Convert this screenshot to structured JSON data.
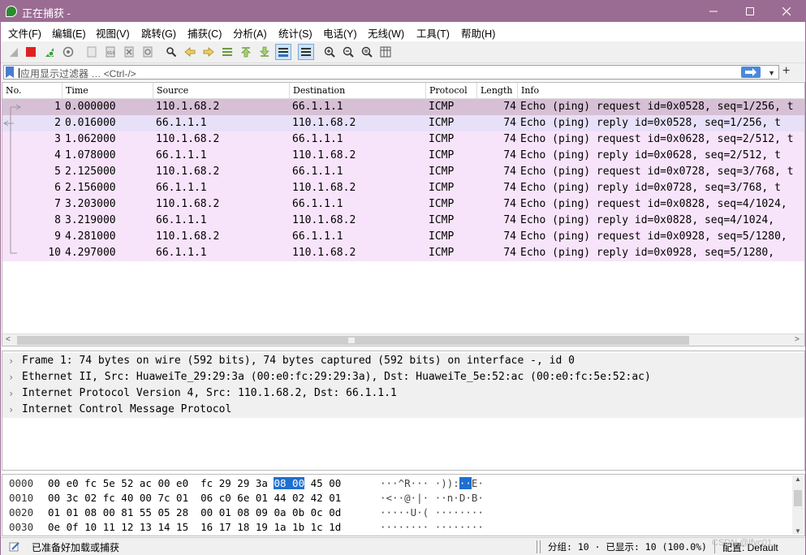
{
  "window": {
    "title": "正在捕获 -"
  },
  "menu": [
    "文件(F)",
    "编辑(E)",
    "视图(V)",
    "跳转(G)",
    "捕获(C)",
    "分析(A)",
    "统计(S)",
    "电话(Y)",
    "无线(W)",
    "工具(T)",
    "帮助(H)"
  ],
  "toolbar": {
    "icons": [
      "shark-fin-start-icon",
      "stop-capture-icon",
      "restart-capture-icon",
      "capture-options-icon",
      "open-file-icon",
      "save-file-icon",
      "close-file-icon",
      "reload-file-icon",
      "find-packet-icon",
      "go-back-icon",
      "go-forward-icon",
      "go-to-packet-icon",
      "first-packet-icon",
      "last-packet-icon",
      "auto-scroll-icon",
      "colorize-icon",
      "zoom-in-icon",
      "zoom-out-icon",
      "normal-size-icon",
      "resize-columns-icon"
    ]
  },
  "filter": {
    "placeholder": "应用显示过滤器 … <Ctrl-/>"
  },
  "columns": [
    "No.",
    "Time",
    "Source",
    "Destination",
    "Protocol",
    "Length",
    "Info"
  ],
  "packets": [
    {
      "no": "1",
      "time": "0.000000",
      "src": "110.1.68.2",
      "dst": "66.1.1.1",
      "proto": "ICMP",
      "len": "74",
      "info": "Echo (ping) request  id=0x0528, seq=1/256, t"
    },
    {
      "no": "2",
      "time": "0.016000",
      "src": "66.1.1.1",
      "dst": "110.1.68.2",
      "proto": "ICMP",
      "len": "74",
      "info": "Echo (ping) reply    id=0x0528, seq=1/256, t"
    },
    {
      "no": "3",
      "time": "1.062000",
      "src": "110.1.68.2",
      "dst": "66.1.1.1",
      "proto": "ICMP",
      "len": "74",
      "info": "Echo (ping) request  id=0x0628, seq=2/512, t"
    },
    {
      "no": "4",
      "time": "1.078000",
      "src": "66.1.1.1",
      "dst": "110.1.68.2",
      "proto": "ICMP",
      "len": "74",
      "info": "Echo (ping) reply    id=0x0628, seq=2/512, t"
    },
    {
      "no": "5",
      "time": "2.125000",
      "src": "110.1.68.2",
      "dst": "66.1.1.1",
      "proto": "ICMP",
      "len": "74",
      "info": "Echo (ping) request  id=0x0728, seq=3/768, t"
    },
    {
      "no": "6",
      "time": "2.156000",
      "src": "66.1.1.1",
      "dst": "110.1.68.2",
      "proto": "ICMP",
      "len": "74",
      "info": "Echo (ping) reply    id=0x0728, seq=3/768, t"
    },
    {
      "no": "7",
      "time": "3.203000",
      "src": "110.1.68.2",
      "dst": "66.1.1.1",
      "proto": "ICMP",
      "len": "74",
      "info": "Echo (ping) request  id=0x0828, seq=4/1024,"
    },
    {
      "no": "8",
      "time": "3.219000",
      "src": "66.1.1.1",
      "dst": "110.1.68.2",
      "proto": "ICMP",
      "len": "74",
      "info": "Echo (ping) reply    id=0x0828, seq=4/1024,"
    },
    {
      "no": "9",
      "time": "4.281000",
      "src": "110.1.68.2",
      "dst": "66.1.1.1",
      "proto": "ICMP",
      "len": "74",
      "info": "Echo (ping) request  id=0x0928, seq=5/1280,"
    },
    {
      "no": "10",
      "time": "4.297000",
      "src": "66.1.1.1",
      "dst": "110.1.68.2",
      "proto": "ICMP",
      "len": "74",
      "info": "Echo (ping) reply    id=0x0928, seq=5/1280,"
    }
  ],
  "details": [
    "Frame 1: 74 bytes on wire (592 bits), 74 bytes captured (592 bits) on interface -, id 0",
    "Ethernet II, Src: HuaweiTe_29:29:3a (00:e0:fc:29:29:3a), Dst: HuaweiTe_5e:52:ac (00:e0:fc:5e:52:ac)",
    "Internet Protocol Version 4, Src: 110.1.68.2, Dst: 66.1.1.1",
    "Internet Control Message Protocol"
  ],
  "bytes": [
    {
      "offset": "0000",
      "hex_a": "00 e0 fc 5e 52 ac 00 e0",
      "hex_b": "fc 29 29 3a",
      "hex_hl": "08 00",
      "hex_c": "45 00",
      "asc_a": "···^R··· ·)):",
      "asc_hl": "··",
      "asc_c": "E·"
    },
    {
      "offset": "0010",
      "hex_a": "00 3c 02 fc 40 00 7c 01",
      "hex_b": "06 c0 6e 01 44 02 42 01",
      "hex_hl": "",
      "hex_c": "",
      "asc_a": "·<··@·|· ··n·D·B·",
      "asc_hl": "",
      "asc_c": ""
    },
    {
      "offset": "0020",
      "hex_a": "01 01 08 00 81 55 05 28",
      "hex_b": "00 01 08 09 0a 0b 0c 0d",
      "hex_hl": "",
      "hex_c": "",
      "asc_a": "·····U·( ········",
      "asc_hl": "",
      "asc_c": ""
    },
    {
      "offset": "0030",
      "hex_a": "0e 0f 10 11 12 13 14 15",
      "hex_b": "16 17 18 19 1a 1b 1c 1d",
      "hex_hl": "",
      "hex_c": "",
      "asc_a": "········ ········",
      "asc_hl": "",
      "asc_c": ""
    }
  ],
  "status": {
    "ready": "已准备好加载或捕获",
    "packets": "分组: 10 · 已显示: 10 (100.0%)",
    "profile": "配置: Default"
  },
  "watermark": "CSDN @lfyc01"
}
